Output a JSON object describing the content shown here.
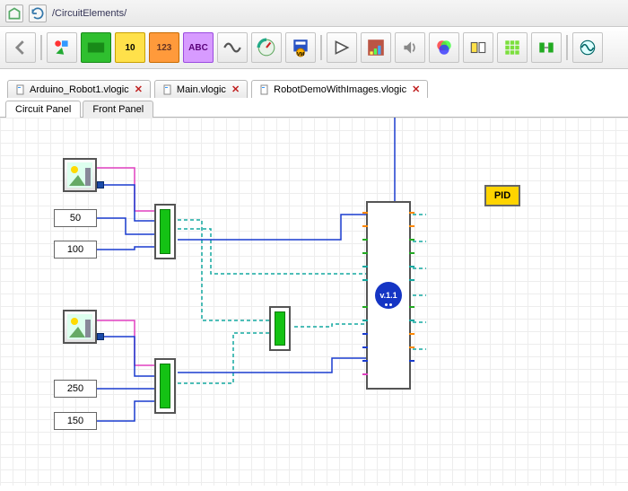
{
  "breadcrumb": {
    "path": "/CircuitElements/"
  },
  "toolbar_icons": [
    "back-arrow",
    "shape-group",
    "bool-constant",
    "int-constant",
    "num-constant",
    "string-constant",
    "sine-wave",
    "gauge",
    "save-vm",
    "amplifier",
    "chart-block",
    "speaker",
    "color-mixer",
    "layout-split",
    "matrix",
    "connector",
    "scope"
  ],
  "file_tabs": [
    {
      "label": "Arduino_Robot1.vlogic",
      "active": false
    },
    {
      "label": "Main.vlogic",
      "active": false
    },
    {
      "label": "RobotDemoWithImages.vlogic",
      "active": true
    }
  ],
  "panel_tabs": [
    {
      "label": "Circuit Panel",
      "active": true
    },
    {
      "label": "Front Panel",
      "active": false
    }
  ],
  "blocks": {
    "image1": {},
    "num50": {
      "value": "50"
    },
    "num100": {
      "value": "100"
    },
    "image2": {},
    "num250": {
      "value": "250"
    },
    "num150": {
      "value": "150"
    },
    "mux1": {},
    "mux2": {},
    "mux3": {},
    "main": {
      "chip_label": "v.1.1"
    },
    "pid": {
      "label": "PID"
    }
  },
  "colors": {
    "wire_blue": "#1a3ccf",
    "wire_magenta": "#e040c0",
    "wire_teal": "#14a8a0",
    "mux_green": "#14c214",
    "pid_yellow": "#ffd400"
  }
}
